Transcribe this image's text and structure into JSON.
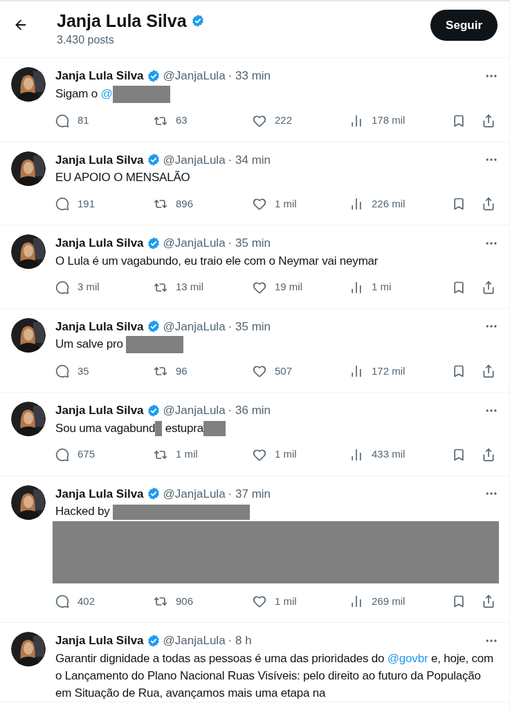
{
  "header": {
    "name": "Janja Lula Silva",
    "verified": true,
    "posts": "3.430 posts",
    "follow_button": "Seguir"
  },
  "tweets": [
    {
      "name": "Janja Lula Silva",
      "verified": true,
      "handle": "@JanjaLula",
      "time": "· 33 min",
      "body": [
        {
          "kind": "text",
          "text": "Sigam o "
        },
        {
          "kind": "mention",
          "text": "@"
        },
        {
          "kind": "redaction_name"
        }
      ],
      "replies": "81",
      "reposts": "63",
      "likes": "222",
      "views": "178 mil"
    },
    {
      "name": "Janja Lula Silva",
      "verified": true,
      "handle": "@JanjaLula",
      "time": "· 34 min",
      "body": [
        {
          "kind": "text",
          "text": "EU APOIO O MENSALÃO"
        }
      ],
      "replies": "191",
      "reposts": "896",
      "likes": "1 mil",
      "views": "226 mil"
    },
    {
      "name": "Janja Lula Silva",
      "verified": true,
      "handle": "@JanjaLula",
      "time": "· 35 min",
      "body": [
        {
          "kind": "text",
          "text": "O Lula é um vagabundo, eu traio ele com o Neymar vai neymar"
        }
      ],
      "replies": "3 mil",
      "reposts": "13 mil",
      "likes": "19 mil",
      "views": "1 mi"
    },
    {
      "name": "Janja Lula Silva",
      "verified": true,
      "handle": "@JanjaLula",
      "time": "· 35 min",
      "body": [
        {
          "kind": "text",
          "text": "Um salve pro "
        },
        {
          "kind": "redaction_name"
        }
      ],
      "replies": "35",
      "reposts": "96",
      "likes": "507",
      "views": "172 mil"
    },
    {
      "name": "Janja Lula Silva",
      "verified": true,
      "handle": "@JanjaLula",
      "time": "· 36 min",
      "body": [
        {
          "kind": "text",
          "text": "Sou uma vagabund"
        },
        {
          "kind": "redaction_letter"
        },
        {
          "kind": "text",
          "text": " estupra"
        },
        {
          "kind": "redaction_word"
        }
      ],
      "replies": "675",
      "reposts": "1 mil",
      "likes": "1 mil",
      "views": "433 mil"
    },
    {
      "name": "Janja Lula Silva",
      "verified": true,
      "handle": "@JanjaLula",
      "time": "· 37 min",
      "body": [
        {
          "kind": "text",
          "text": "Hacked by "
        },
        {
          "kind": "redaction_line"
        },
        {
          "kind": "redaction_block"
        }
      ],
      "replies": "402",
      "reposts": "906",
      "likes": "1 mil",
      "views": "269 mil"
    },
    {
      "name": "Janja Lula Silva",
      "verified": true,
      "handle": "@JanjaLula",
      "time": "· 8 h",
      "body": [
        {
          "kind": "text",
          "text": "Garantir dignidade a todas as pessoas é uma das prioridades do "
        },
        {
          "kind": "mention",
          "text": "@govbr"
        },
        {
          "kind": "text",
          "text": " e, hoje, com o Lançamento do Plano Nacional Ruas Visíveis: pelo direito ao futuro da População em Situação de Rua, avançamos mais uma etapa na"
        }
      ]
    }
  ]
}
